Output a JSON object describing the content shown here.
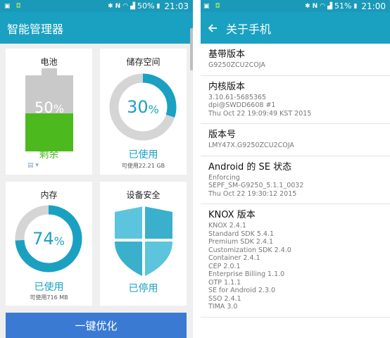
{
  "left": {
    "status": {
      "battery_pct": "50%",
      "time": "21:03"
    },
    "app_title": "智能管理器",
    "battery_card": {
      "title": "电池",
      "value": "50",
      "unit": "%",
      "status": "剩余",
      "level": 0.5
    },
    "storage_card": {
      "title": "储存空间",
      "value": "30",
      "unit": "%",
      "status": "已使用",
      "sub": "可使用22.21 GB",
      "level": 0.3
    },
    "memory_card": {
      "title": "内存",
      "value": "74",
      "unit": "%",
      "status": "已使用",
      "sub": "可使用716 MB",
      "level": 0.74
    },
    "security_card": {
      "title": "设备安全",
      "status": "已停用"
    },
    "optimize_button": "一键优化",
    "colors": {
      "accent": "#1aa1c2",
      "battery_green": "#4cba1e",
      "button_blue": "#3b7ad3",
      "ring_gray": "#d5d5d5"
    }
  },
  "right": {
    "status": {
      "battery_pct": "51%",
      "time": "21:00"
    },
    "title": "关于手机",
    "items": [
      {
        "title": "基带版本",
        "lines": [
          "G9250ZCU2COJA"
        ]
      },
      {
        "title": "内核版本",
        "lines": [
          "3.10.61-5685365",
          "dpi@SWDD6608 #1",
          "Thu Oct 22 19:09:49 KST 2015"
        ]
      },
      {
        "title": "版本号",
        "lines": [
          "LMY47X.G9250ZCU2COJA"
        ]
      },
      {
        "title": "Android 的 SE 状态",
        "lines": [
          "Enforcing",
          "SEPF_SM-G9250_5.1.1_0032",
          "Thu Oct 22 19:30:12 2015"
        ]
      },
      {
        "title": "KNOX 版本",
        "lines": [
          "KNOX 2.4.1",
          "Standard SDK 5.4.1",
          "Premium SDK 2.4.1",
          "Customization SDK 2.4.0",
          "Container 2.4.1",
          "CEP 2.0.1",
          "Enterprise Billing 1.1.0",
          "OTP 1.1.1",
          "SE for Android 2.3.0",
          "SSO 2.4.1",
          "TIMA 3.0"
        ]
      }
    ]
  }
}
